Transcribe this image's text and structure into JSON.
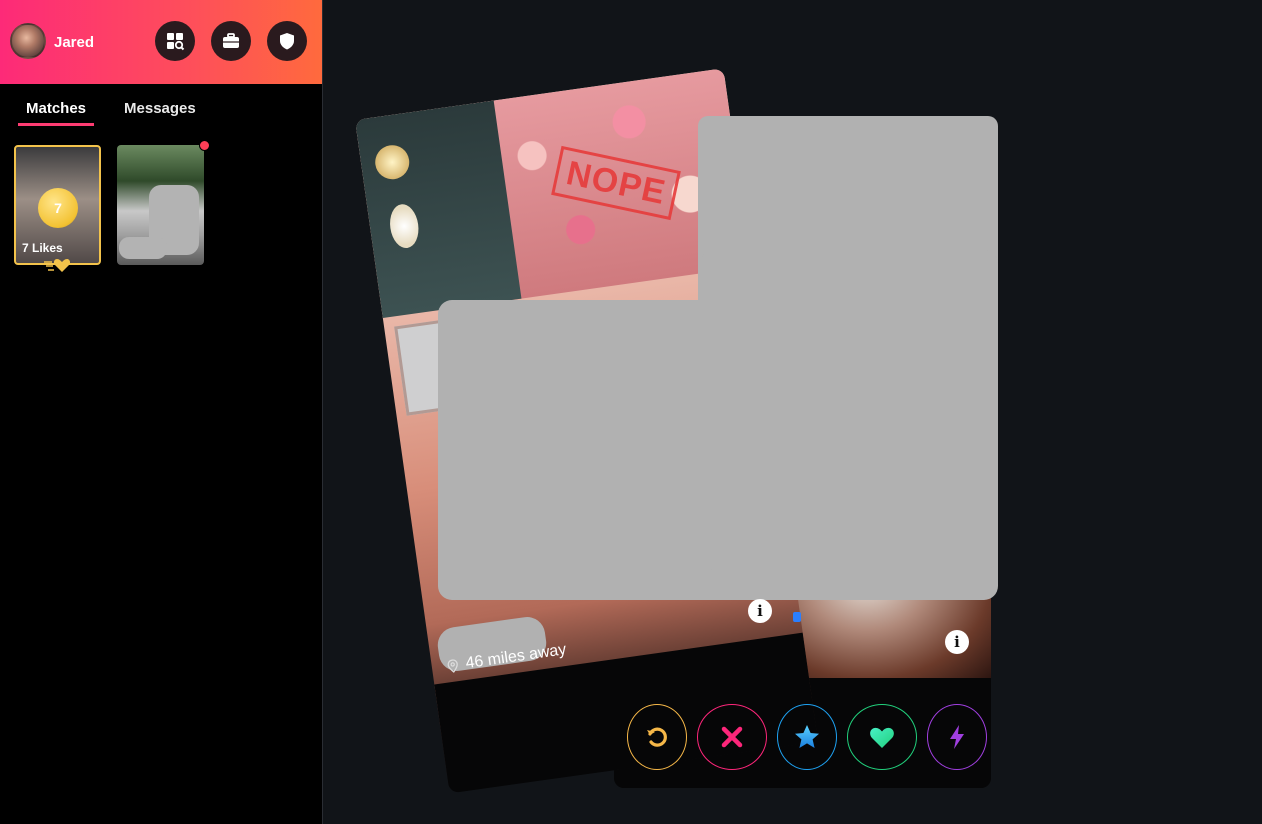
{
  "user": {
    "name": "Jared"
  },
  "header_buttons": [
    "explore-icon",
    "briefcase-icon",
    "shield-icon"
  ],
  "tabs": [
    {
      "label": "Matches",
      "active": true
    },
    {
      "label": "Messages",
      "active": false
    }
  ],
  "likes_card": {
    "count": "7",
    "label": "7 Likes"
  },
  "profile": {
    "distance": "46 miles away",
    "stamp": "NOPE"
  },
  "actions": [
    "rewind-icon",
    "nope-icon",
    "super-like-icon",
    "like-icon",
    "boost-icon"
  ],
  "colors": {
    "brand_start": "#fd2a78",
    "brand_end": "#ff6a3d",
    "rewind": "#f5b748",
    "nope": "#fd267a",
    "super_like": "#1ea1f1",
    "like": "#21d07c",
    "boost": "#a03fe0"
  }
}
